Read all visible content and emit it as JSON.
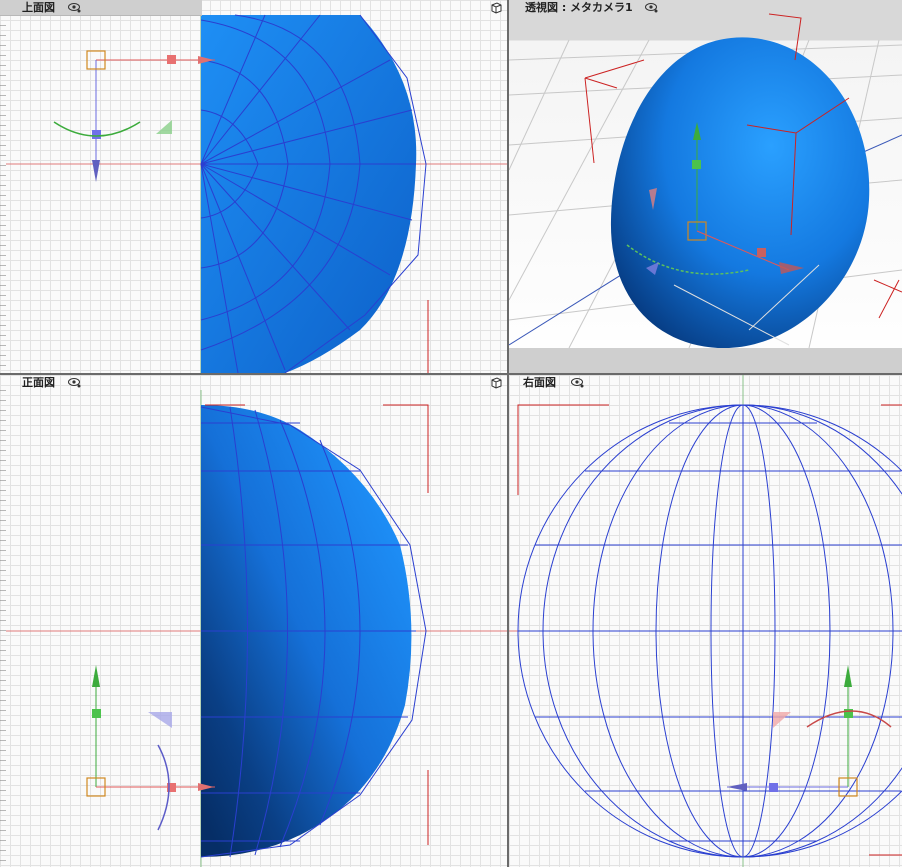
{
  "viewports": {
    "top": {
      "title": "上面図"
    },
    "perspective": {
      "title": "透視図 : メタカメラ1"
    },
    "front": {
      "title": "正面図"
    },
    "right": {
      "title": "右面図"
    }
  },
  "colors": {
    "object": "#1a7fe8",
    "wire": "#2a3fd0",
    "axis_x": "#e05858",
    "axis_y": "#3cab3c",
    "axis_z": "#6a6ae0",
    "manip_center": "#d08820",
    "camera_marks": "#cc2222"
  },
  "icons": {
    "visibility": "eye-icon",
    "view_cube": "cube-icon"
  }
}
